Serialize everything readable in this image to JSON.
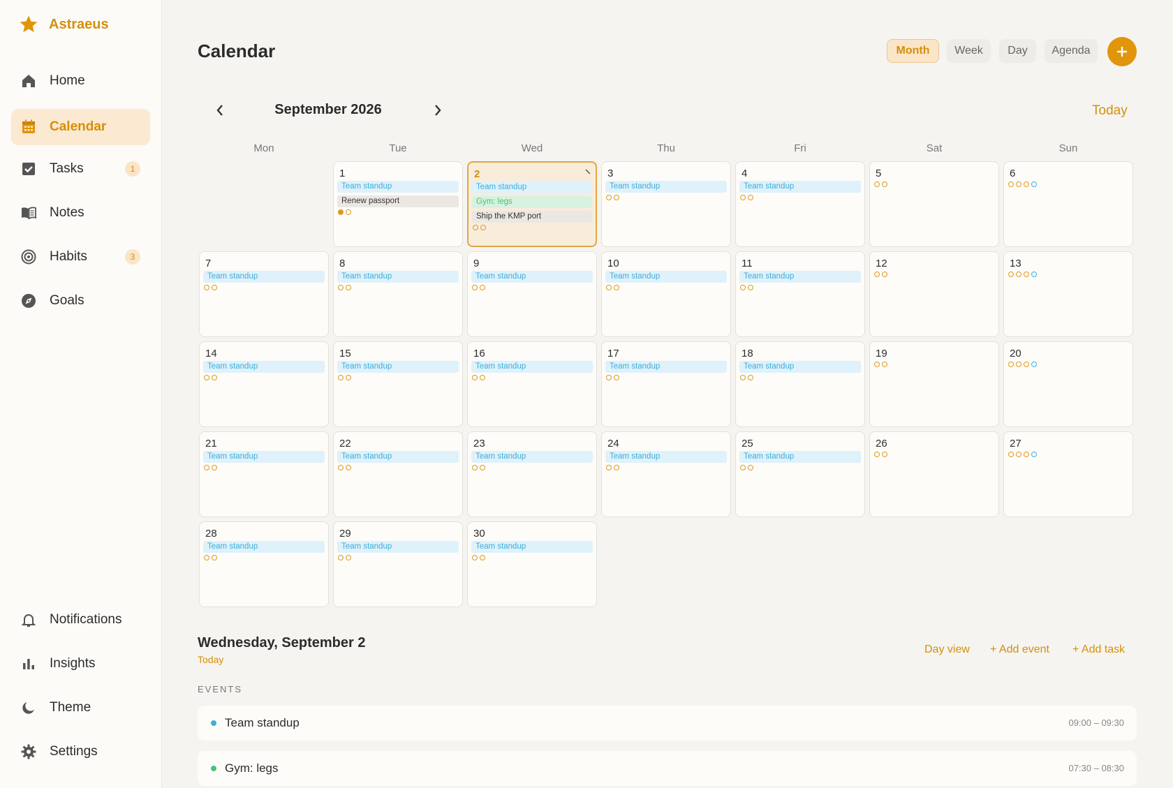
{
  "app": {
    "name": "Astraeus"
  },
  "sidebar": {
    "items": [
      {
        "label": "Home",
        "icon": "home-icon"
      },
      {
        "label": "Calendar",
        "icon": "calendar-icon",
        "active": true
      },
      {
        "label": "Tasks",
        "icon": "checkbox-icon",
        "badge": "1"
      },
      {
        "label": "Notes",
        "icon": "book-icon"
      },
      {
        "label": "Habits",
        "icon": "target-icon",
        "badge": "3"
      },
      {
        "label": "Goals",
        "icon": "compass-icon"
      }
    ],
    "bottom_items": [
      {
        "label": "Notifications",
        "icon": "bell-icon"
      },
      {
        "label": "Insights",
        "icon": "bar-chart-icon"
      },
      {
        "label": "Theme",
        "icon": "moon-icon"
      },
      {
        "label": "Settings",
        "icon": "gear-icon"
      }
    ]
  },
  "header": {
    "title": "Calendar",
    "views": [
      "Month",
      "Week",
      "Day",
      "Agenda"
    ],
    "active_view": "Month"
  },
  "calendar": {
    "month_label": "September 2026",
    "today_label": "Today",
    "weekdays": [
      "Mon",
      "Tue",
      "Wed",
      "Thu",
      "Fri",
      "Sat",
      "Sun"
    ],
    "first_weekday_index": 1,
    "selected_day": 2,
    "days": [
      {
        "day": "1",
        "events": [
          {
            "t": "Team standup",
            "c": "blue"
          },
          {
            "t": "Renew passport",
            "c": "gray"
          }
        ],
        "dots": [
          "fill",
          "o"
        ]
      },
      {
        "day": "2",
        "events": [
          {
            "t": "Team standup",
            "c": "blue"
          },
          {
            "t": "Gym: legs",
            "c": "green"
          },
          {
            "t": "Ship the KMP port",
            "c": "gray"
          }
        ],
        "dots": [
          "o",
          "o"
        ]
      },
      {
        "day": "3",
        "events": [
          {
            "t": "Team standup",
            "c": "blue"
          }
        ],
        "dots": [
          "o",
          "o"
        ]
      },
      {
        "day": "4",
        "events": [
          {
            "t": "Team standup",
            "c": "blue"
          }
        ],
        "dots": [
          "o",
          "o"
        ]
      },
      {
        "day": "5",
        "events": [],
        "dots": [
          "o",
          "o"
        ]
      },
      {
        "day": "6",
        "events": [],
        "dots": [
          "o",
          "o",
          "o",
          "teal"
        ]
      },
      {
        "day": "7",
        "events": [
          {
            "t": "Team standup",
            "c": "blue"
          }
        ],
        "dots": [
          "o",
          "o"
        ]
      },
      {
        "day": "8",
        "events": [
          {
            "t": "Team standup",
            "c": "blue"
          }
        ],
        "dots": [
          "o",
          "o"
        ]
      },
      {
        "day": "9",
        "events": [
          {
            "t": "Team standup",
            "c": "blue"
          }
        ],
        "dots": [
          "o",
          "o"
        ]
      },
      {
        "day": "10",
        "events": [
          {
            "t": "Team standup",
            "c": "blue"
          }
        ],
        "dots": [
          "o",
          "o"
        ]
      },
      {
        "day": "11",
        "events": [
          {
            "t": "Team standup",
            "c": "blue"
          }
        ],
        "dots": [
          "o",
          "o"
        ]
      },
      {
        "day": "12",
        "events": [],
        "dots": [
          "o",
          "o"
        ]
      },
      {
        "day": "13",
        "events": [],
        "dots": [
          "o",
          "o",
          "o",
          "teal"
        ]
      },
      {
        "day": "14",
        "events": [
          {
            "t": "Team standup",
            "c": "blue"
          }
        ],
        "dots": [
          "o",
          "o"
        ]
      },
      {
        "day": "15",
        "events": [
          {
            "t": "Team standup",
            "c": "blue"
          }
        ],
        "dots": [
          "o",
          "o"
        ]
      },
      {
        "day": "16",
        "events": [
          {
            "t": "Team standup",
            "c": "blue"
          }
        ],
        "dots": [
          "o",
          "o"
        ]
      },
      {
        "day": "17",
        "events": [
          {
            "t": "Team standup",
            "c": "blue"
          }
        ],
        "dots": [
          "o",
          "o"
        ]
      },
      {
        "day": "18",
        "events": [
          {
            "t": "Team standup",
            "c": "blue"
          }
        ],
        "dots": [
          "o",
          "o"
        ]
      },
      {
        "day": "19",
        "events": [],
        "dots": [
          "o",
          "o"
        ]
      },
      {
        "day": "20",
        "events": [],
        "dots": [
          "o",
          "o",
          "o",
          "teal"
        ]
      },
      {
        "day": "21",
        "events": [
          {
            "t": "Team standup",
            "c": "blue"
          }
        ],
        "dots": [
          "o",
          "o"
        ]
      },
      {
        "day": "22",
        "events": [
          {
            "t": "Team standup",
            "c": "blue"
          }
        ],
        "dots": [
          "o",
          "o"
        ]
      },
      {
        "day": "23",
        "events": [
          {
            "t": "Team standup",
            "c": "blue"
          }
        ],
        "dots": [
          "o",
          "o"
        ]
      },
      {
        "day": "24",
        "events": [
          {
            "t": "Team standup",
            "c": "blue"
          }
        ],
        "dots": [
          "o",
          "o"
        ]
      },
      {
        "day": "25",
        "events": [
          {
            "t": "Team standup",
            "c": "blue"
          }
        ],
        "dots": [
          "o",
          "o"
        ]
      },
      {
        "day": "26",
        "events": [],
        "dots": [
          "o",
          "o"
        ]
      },
      {
        "day": "27",
        "events": [],
        "dots": [
          "o",
          "o",
          "o",
          "teal"
        ]
      },
      {
        "day": "28",
        "events": [
          {
            "t": "Team standup",
            "c": "blue"
          }
        ],
        "dots": [
          "o",
          "o"
        ]
      },
      {
        "day": "29",
        "events": [
          {
            "t": "Team standup",
            "c": "blue"
          }
        ],
        "dots": [
          "o",
          "o"
        ]
      },
      {
        "day": "30",
        "events": [
          {
            "t": "Team standup",
            "c": "blue"
          }
        ],
        "dots": [
          "o",
          "o"
        ]
      }
    ]
  },
  "day_detail": {
    "title": "Wednesday, September 2",
    "subtitle": "Today",
    "actions": [
      "Day view",
      "+ Add event",
      "+ Add task"
    ],
    "events_heading": "EVENTS",
    "events": [
      {
        "name": "Team standup",
        "time": "09:00 – 09:30",
        "color": "#3eaed9"
      },
      {
        "name": "Gym: legs",
        "time": "07:30 – 08:30",
        "color": "#46c377"
      }
    ]
  },
  "colors": {
    "accent": "#d4900a",
    "event_blue": "#3eaed9",
    "event_green": "#46c377"
  }
}
